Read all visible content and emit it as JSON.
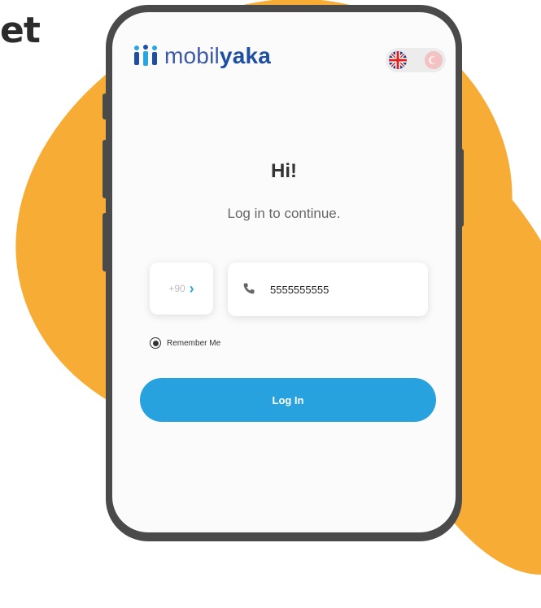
{
  "background": {
    "heading_fragment": "et"
  },
  "app": {
    "brand": {
      "prefix": "mobil",
      "suffix": "yaka"
    },
    "language_toggle": {
      "options": [
        "english-flag-icon",
        "turkish-flag-icon"
      ],
      "selected": "english"
    }
  },
  "login": {
    "greeting": "Hi!",
    "subtitle": "Log in to continue.",
    "country_code": "+90",
    "phone_value": "5555555555",
    "remember_label": "Remember Me",
    "remember_checked": true,
    "login_label": "Log In"
  },
  "colors": {
    "accent_orange": "#f6ac35",
    "button_blue": "#27a2de",
    "brand_blue": "#1f4fa3"
  }
}
